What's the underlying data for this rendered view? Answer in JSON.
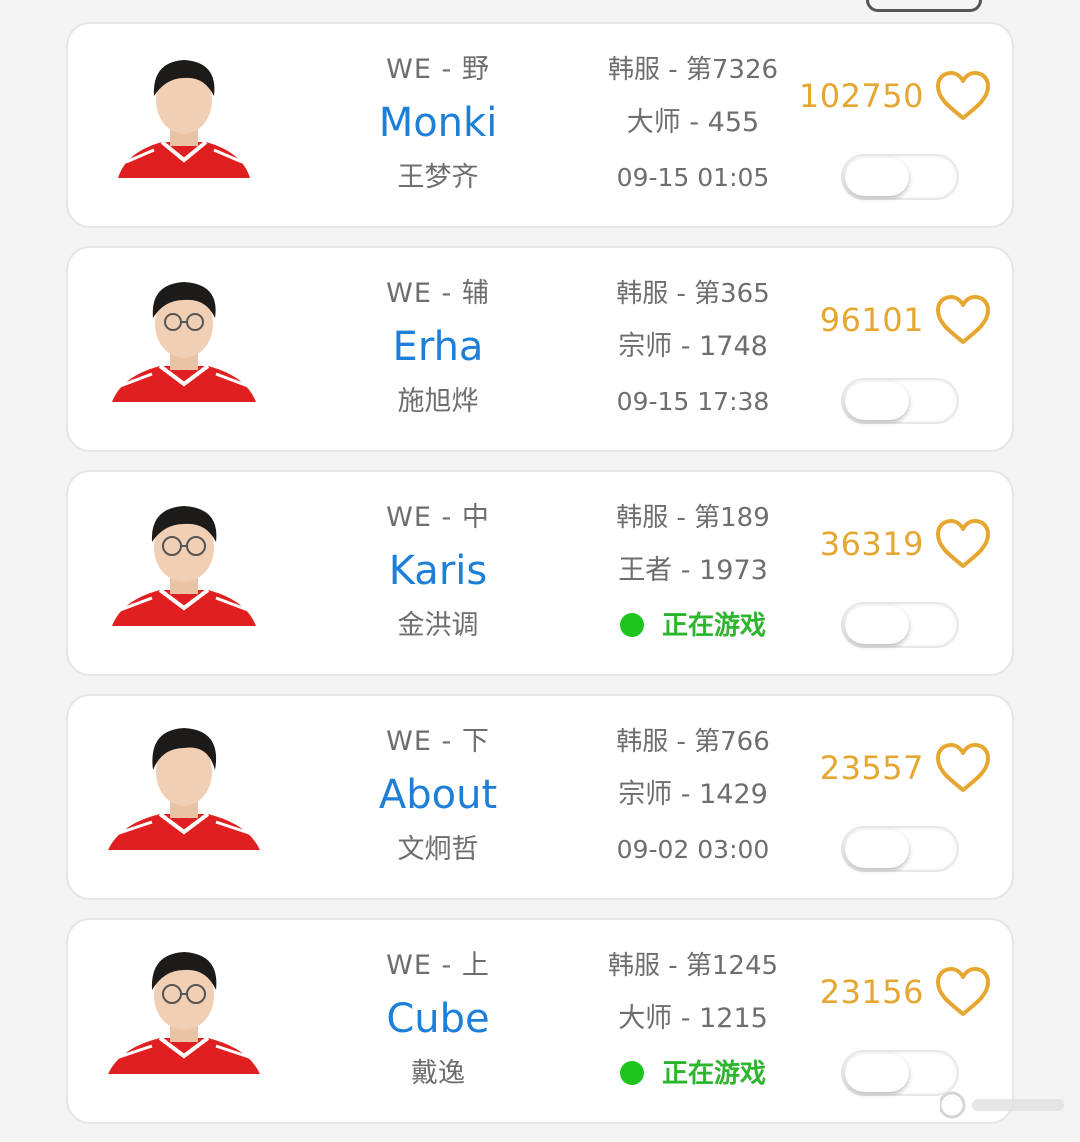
{
  "players": [
    {
      "team_pos": "WE - 野",
      "name": "Monki",
      "real_name": "王梦齐",
      "rank": "韩服 - 第7326",
      "tier": "大师 - 455",
      "time": "09-15 01:05",
      "status": "",
      "likes": "102750",
      "toggle_on": false
    },
    {
      "team_pos": "WE - 辅",
      "name": "Erha",
      "real_name": "施旭烨",
      "rank": "韩服 - 第365",
      "tier": "宗师 - 1748",
      "time": "09-15 17:38",
      "status": "",
      "likes": "96101",
      "toggle_on": false
    },
    {
      "team_pos": "WE - 中",
      "name": "Karis",
      "real_name": "金洪调",
      "rank": "韩服 - 第189",
      "tier": "王者 - 1973",
      "time": "",
      "status": "正在游戏",
      "likes": "36319",
      "toggle_on": false
    },
    {
      "team_pos": "WE - 下",
      "name": "About",
      "real_name": "文炯哲",
      "rank": "韩服 - 第766",
      "tier": "宗师 - 1429",
      "time": "09-02 03:00",
      "status": "",
      "likes": "23557",
      "toggle_on": false
    },
    {
      "team_pos": "WE - 上",
      "name": "Cube",
      "real_name": "戴逸",
      "rank": "韩服 - 第1245",
      "tier": "大师 - 1215",
      "time": "",
      "status": "正在游戏",
      "likes": "23156",
      "toggle_on": false
    }
  ],
  "colors": {
    "name_blue": "#1e7fd8",
    "likes_gold": "#e6a732",
    "status_green": "#2db52d",
    "jersey_red": "#e02020"
  },
  "icons": {
    "like": "heart-outline-icon",
    "online": "green-dot-icon"
  }
}
